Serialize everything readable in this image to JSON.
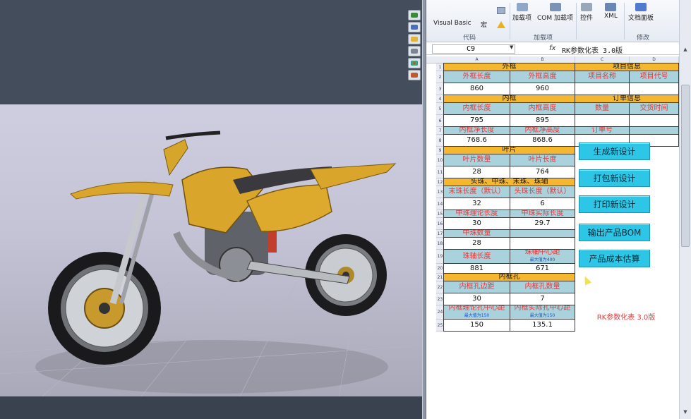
{
  "ribbon": {
    "buttons": [
      {
        "label": "Visual Basic",
        "icon": "vb-icon"
      },
      {
        "label": "宏",
        "icon": "macro-icon"
      },
      {
        "label": "加载项",
        "icon": "addin-icon"
      },
      {
        "label": "COM 加载项",
        "icon": "com-addin-icon"
      },
      {
        "label": "控件",
        "icon": "controls-icon"
      },
      {
        "label": "XML",
        "icon": "xml-icon"
      },
      {
        "label": "文档面板",
        "icon": "doc-panel-icon"
      }
    ],
    "groups": [
      "代码",
      "加载项",
      "修改"
    ]
  },
  "formula_bar": {
    "name_box": "C9",
    "fx": "fx",
    "content": "RK参数化表 3.0版"
  },
  "columns": [
    "A",
    "B",
    "C",
    "D"
  ],
  "rows": [
    "1",
    "2",
    "3",
    "4",
    "5",
    "6",
    "7",
    "8",
    "9",
    "10",
    "11",
    "12",
    "13",
    "14",
    "15",
    "16",
    "17",
    "18",
    "19",
    "20",
    "21",
    "22",
    "23",
    "24",
    "25"
  ],
  "sheet": {
    "outer_frame": "外框",
    "outer_length_label": "外框长度",
    "outer_height_label": "外框高度",
    "outer_length": "860",
    "outer_height": "960",
    "inner_frame": "内框",
    "inner_length_label": "内框长度",
    "inner_height_label": "内框高度",
    "inner_length": "795",
    "inner_height": "895",
    "inner_net_length_label": "内框净长度",
    "inner_net_height_label": "内框净高度",
    "inner_net_length": "768.6",
    "inner_net_height": "868.6",
    "blade": "叶片",
    "blade_count_label": "叶片数量",
    "blade_length_label": "叶片长度",
    "blade_count": "28",
    "blade_length": "764",
    "bead_header": "头珠、中珠、末珠、珠轴",
    "end_bead_len_label": "末珠长度（默认）",
    "head_bead_len_label": "头珠长度（默认）",
    "end_bead_len": "32",
    "head_bead_len": "6",
    "mid_bead_theory_label": "中珠理论长度",
    "mid_bead_actual_label": "中珠实际长度",
    "mid_bead_theory": "30",
    "mid_bead_actual": "29.7",
    "mid_bead_count_label": "中珠数量",
    "mid_bead_count": "28",
    "axle_length_label": "珠轴长度",
    "axle_center_label": "珠轴中心距",
    "axle_center_note": "最大值为400",
    "axle_length": "881",
    "axle_center": "671",
    "inner_hole": "内框孔",
    "hole_edge_label": "内框孔边距",
    "hole_count_label": "内框孔数量",
    "hole_edge": "30",
    "hole_count": "7",
    "hole_theory_center_label": "内框理论孔中心距",
    "hole_actual_center_label": "内框实际孔中心距",
    "hole_center_note": "最大值为150",
    "hole_theory_center": "150",
    "hole_actual_center": "135.1",
    "project_info": "项目信息",
    "project_name_label": "项目名称",
    "project_code_label": "项目代号",
    "order_info": "订单信息",
    "quantity_label": "数量",
    "delivery_label": "交货时间",
    "order_no_label": "订单号",
    "footer": "RK参数化表 3.0版"
  },
  "actions": [
    "生成新设计",
    "打包新设计",
    "打印新设计",
    "输出产品BOM",
    "产品成本估算"
  ],
  "colors": {
    "header_orange": "#f5b730",
    "label_blue": "#a9d2dc",
    "button_cyan": "#2ec6e6",
    "label_red": "#e03a3a",
    "bike_yellow": "#d9a52a"
  }
}
